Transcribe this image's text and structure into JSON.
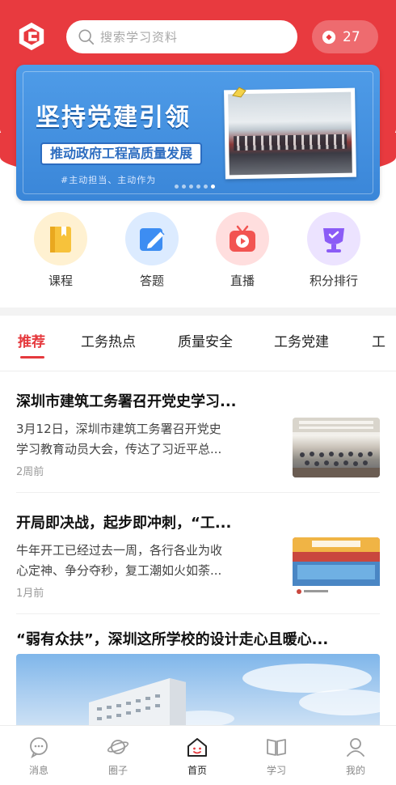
{
  "header": {
    "search_placeholder": "搜索学习资料",
    "points": "27"
  },
  "banner": {
    "headline": "坚持党建引领",
    "subheadline": "推动政府工程高质量发展",
    "tags": "#主动担当、主动作为",
    "slides_total": 6,
    "slide_active": 6
  },
  "quick_actions": [
    {
      "label": "课程",
      "icon": "book-icon",
      "color": "#f7c23b"
    },
    {
      "label": "答题",
      "icon": "pencil-icon",
      "color": "#3d8df2"
    },
    {
      "label": "直播",
      "icon": "tv-icon",
      "color": "#f25451"
    },
    {
      "label": "积分排行",
      "icon": "trophy-icon",
      "color": "#8b5cf6"
    }
  ],
  "tabs": [
    "推荐",
    "工务热点",
    "质量安全",
    "工务党建",
    "工"
  ],
  "active_tab": "推荐",
  "articles": [
    {
      "title": "深圳市建筑工务署召开党史学习...",
      "summary_line1": "3月12日，深圳市建筑工务署召开党史",
      "summary_line2": "学习教育动员大会，传达了习近平总...",
      "time": "2周前"
    },
    {
      "title": "开局即决战，起步即冲刺，“工...",
      "summary_line1": "牛年开工已经过去一周，各行各业为收",
      "summary_line2": "心定神、争分夺秒，复工潮如火如荼...",
      "time": "1月前"
    },
    {
      "title": "“弱有众扶”，深圳这所学校的设计走心且暖心..."
    }
  ],
  "tabbar": [
    {
      "label": "消息",
      "icon": "chat-icon"
    },
    {
      "label": "圈子",
      "icon": "planet-icon"
    },
    {
      "label": "首页",
      "icon": "home-icon"
    },
    {
      "label": "学习",
      "icon": "open-book-icon"
    },
    {
      "label": "我的",
      "icon": "person-icon"
    }
  ],
  "tabbar_active": "首页",
  "colors": {
    "brand_red": "#e83a3f",
    "active_tab": "#e5393d",
    "banner_blue": "#3a86d8"
  }
}
